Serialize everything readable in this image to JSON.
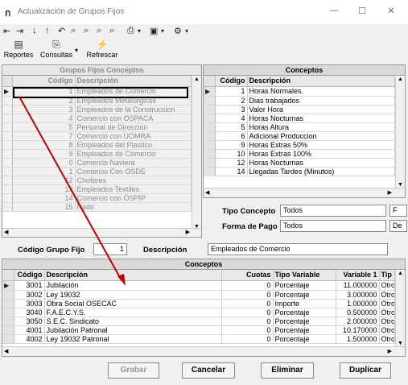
{
  "window": {
    "title": "Actualización de Grupos Fijos",
    "minimize": "—",
    "maximize": "☐",
    "close": "✕"
  },
  "toolbar": {
    "reports_label": "Reportes",
    "queries_label": "Consultas",
    "refresh_label": "Refrescar"
  },
  "groups_grid": {
    "title": "Grupos Fijos Conceptos",
    "col_code": "Código",
    "col_desc": "Descripción",
    "rows": [
      {
        "code": "1",
        "desc": "Empleados de Comercio"
      },
      {
        "code": "2",
        "desc": "Empleados Metalúrgicos"
      },
      {
        "code": "3",
        "desc": "Empleados de la Construccion"
      },
      {
        "code": "4",
        "desc": "Comercio con OSPACA"
      },
      {
        "code": "5",
        "desc": "Personal de Direccion"
      },
      {
        "code": "7",
        "desc": "Comercio con UOMRA"
      },
      {
        "code": "8",
        "desc": "Empleados del Plastico"
      },
      {
        "code": "9",
        "desc": "Empleados de Comercio"
      },
      {
        "code": "0",
        "desc": "Comercio Naviera"
      },
      {
        "code": "1",
        "desc": "Comercio Con OSDE"
      },
      {
        "code": "12",
        "desc": "Choferes"
      },
      {
        "code": "13",
        "desc": "Empleados Textiles"
      },
      {
        "code": "14",
        "desc": "Comercio con OSPIP"
      },
      {
        "code": "15",
        "desc": "Nado"
      }
    ]
  },
  "concepts_top": {
    "title": "Conceptos",
    "col_code": "Código",
    "col_desc": "Descripción",
    "rows": [
      {
        "code": "1",
        "desc": "Horas Normales."
      },
      {
        "code": "2",
        "desc": "Dias trabajados"
      },
      {
        "code": "3",
        "desc": "Valor Hora"
      },
      {
        "code": "4",
        "desc": "Horas Nocturnas"
      },
      {
        "code": "5",
        "desc": "Horas Altura"
      },
      {
        "code": "6",
        "desc": "Adicional Produccion"
      },
      {
        "code": "9",
        "desc": "Horas Extras 50%"
      },
      {
        "code": "10",
        "desc": "Horas Extras 100%"
      },
      {
        "code": "12",
        "desc": "Horas Nocturnas"
      },
      {
        "code": "14",
        "desc": "Llegadas Tardes (Minutos)"
      }
    ]
  },
  "filters": {
    "tipo_label": "Tipo Concepto",
    "tipo_value": "Todos",
    "forma_label": "Forma de Pago",
    "forma_value": "Todos",
    "extra1": "F",
    "extra2": "De"
  },
  "group_form": {
    "code_label": "Código Grupo Fijo",
    "code_value": "1",
    "desc_label": "Descripción",
    "desc_value": "Empleados de Comercio"
  },
  "concepts_bottom": {
    "title": "Conceptos",
    "col_code": "Código",
    "col_desc": "Descripción",
    "col_cuotas": "Cuotas",
    "col_tipo": "Tipo Variable",
    "col_var1": "Variable 1",
    "col_tip": "Tip",
    "rows": [
      {
        "code": "3001",
        "desc": "Jubilación",
        "cuotas": "0",
        "tipo": "Porcentaje",
        "var1": "11.000000",
        "tip": "Otro"
      },
      {
        "code": "3002",
        "desc": "Ley 19032",
        "cuotas": "0",
        "tipo": "Porcentaje",
        "var1": "3.000000",
        "tip": "Otro"
      },
      {
        "code": "3003",
        "desc": "Obra Social OSECAC",
        "cuotas": "0",
        "tipo": "Importe",
        "var1": "1.000000",
        "tip": "Otro"
      },
      {
        "code": "3040",
        "desc": "F.A.E.C.Y.S.",
        "cuotas": "0",
        "tipo": "Porcentaje",
        "var1": "0.500000",
        "tip": "Otro"
      },
      {
        "code": "3050",
        "desc": "S.E.C. Sindicato",
        "cuotas": "0",
        "tipo": "Porcentaje",
        "var1": "2.000000",
        "tip": "Otro"
      },
      {
        "code": "4001",
        "desc": "Jubilación Patronal",
        "cuotas": "0",
        "tipo": "Porcentaje",
        "var1": "10.170000",
        "tip": "Otro"
      },
      {
        "code": "4002",
        "desc": "Ley 19032 Patronal",
        "cuotas": "0",
        "tipo": "Porcentaje",
        "var1": "1.500000",
        "tip": "Otro"
      }
    ]
  },
  "buttons": {
    "save": "Grabar",
    "cancel": "Cancelar",
    "delete": "Eliminar",
    "duplicate": "Duplicar"
  }
}
